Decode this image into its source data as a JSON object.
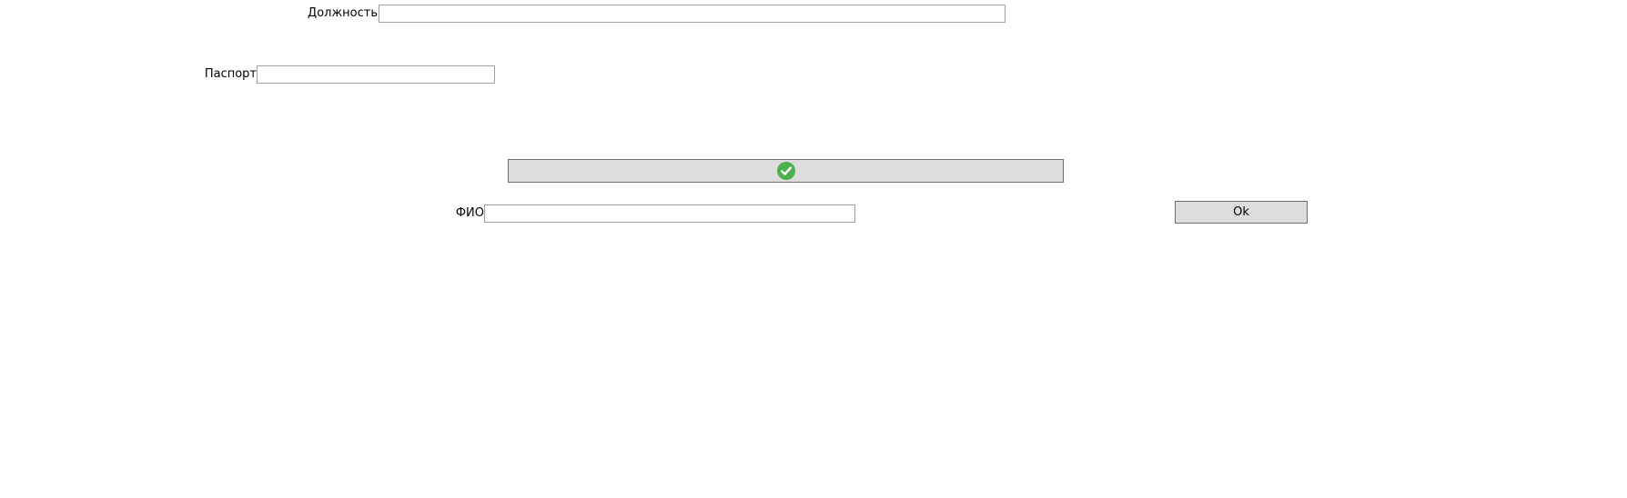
{
  "form": {
    "position": {
      "label": "Должность",
      "value": "",
      "placeholder": ""
    },
    "passport": {
      "label": "Паспорт",
      "value": "",
      "placeholder": ""
    },
    "fio": {
      "label": "ФИО",
      "value": "",
      "placeholder": ""
    }
  },
  "confirm_button": {
    "icon": "check-circle-icon",
    "icon_color": "#4cb050"
  },
  "ok_button": {
    "label": "Ok"
  }
}
